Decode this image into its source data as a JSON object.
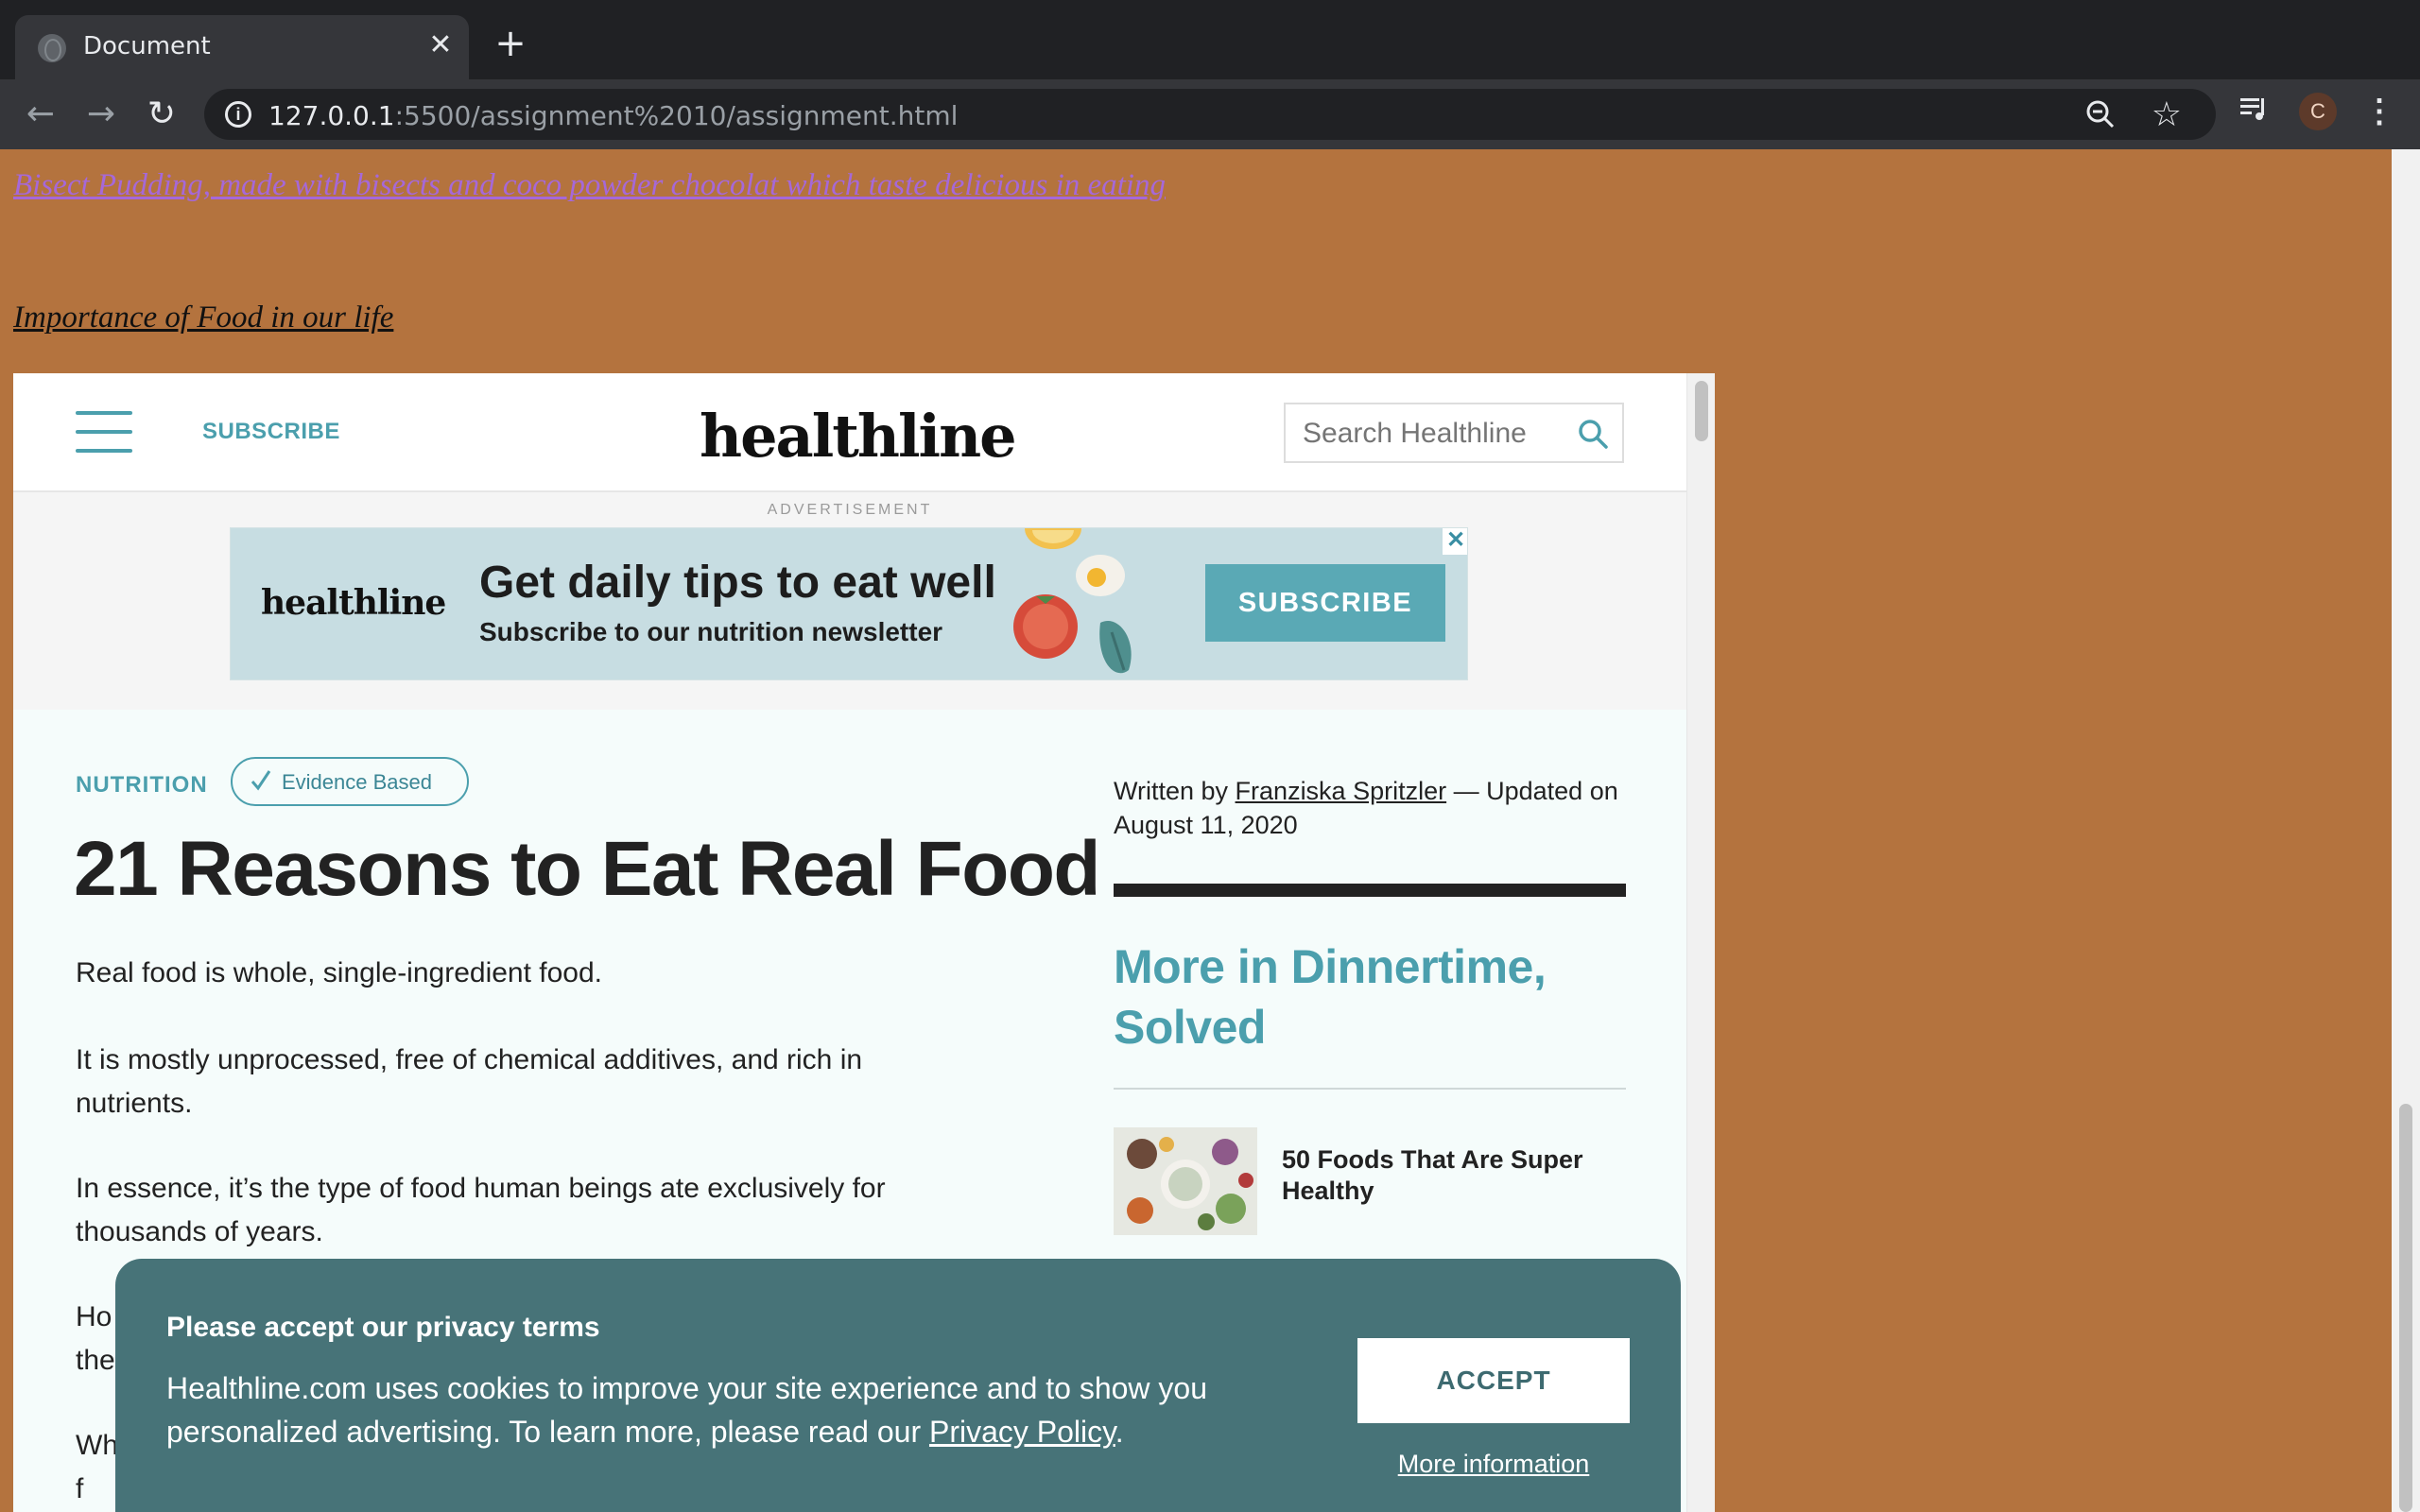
{
  "browser": {
    "tab_title": "Document",
    "tab_close": "✕",
    "new_tab": "+",
    "back": "←",
    "forward": "→",
    "reload": "↻",
    "url_host": "127.0.0.1",
    "url_rest": ":5500/assignment%2010/assignment.html",
    "bookmark": "☆",
    "avatar_letter": "C",
    "menu": "⋮"
  },
  "page": {
    "link_pudding": "Bisect Pudding, made with bisects and coco powder chocolat which taste delicious in eating",
    "link_importance": "Importance of Food in our life"
  },
  "healthline": {
    "subscribe": "SUBSCRIBE",
    "logo": "healthline",
    "search_placeholder": "Search Healthline",
    "ad": {
      "label": "ADVERTISEMENT",
      "logo": "healthline",
      "title": "Get daily tips to eat well",
      "subtitle": "Subscribe to our nutrition newsletter",
      "button": "SUBSCRIBE",
      "close": "✕"
    },
    "article": {
      "category": "NUTRITION",
      "badge": "Evidence Based",
      "title": "21 Reasons to Eat Real Food",
      "paragraphs": [
        "Real food is whole, single-ingredient food.",
        "It is mostly unprocessed, free of chemical additives, and rich in nutrients.",
        "In essence, it’s the type of food human beings ate exclusively for thousands of years.",
        "Ho",
        "the",
        "Wh",
        "f"
      ]
    },
    "sidebar": {
      "byline_prefix": "Written by ",
      "author": "Franziska Spritzler",
      "byline_suffix": " — Updated on August 11, 2020",
      "heading": "More in Dinnertime, Solved",
      "link": "50 Foods That Are Super Healthy"
    }
  },
  "cookie": {
    "title": "Please accept our privacy terms",
    "text_prefix": "Healthline.com uses cookies to improve your site experience and to show you personalized advertising. To learn more, please read our ",
    "policy_link": "Privacy Policy",
    "text_suffix": ".",
    "accept": "ACCEPT",
    "more_info": "More information"
  },
  "colors": {
    "page_background": "#b4733e",
    "healthline_teal": "#4b9fad",
    "cookie_banner": "#477378",
    "visited_link": "#a668d8"
  }
}
